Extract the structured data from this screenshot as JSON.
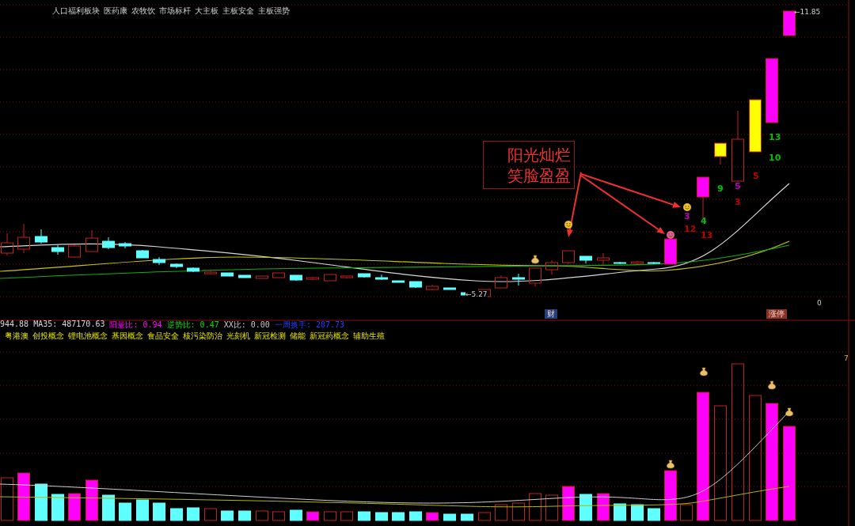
{
  "top_sector_tags": [
    "人口福利板块",
    "医药康",
    "农牧饮",
    "市场标杆",
    "大主板",
    "主板安全",
    "主板强势"
  ],
  "price_labels": {
    "high": "←11.85",
    "low": "←5.27",
    "right_scale": "0"
  },
  "annotation": {
    "lines": [
      "阳光灿烂",
      "笑脸盈盈"
    ]
  },
  "count_labels": [
    {
      "text": "9",
      "color": "#00c000"
    },
    {
      "text": "5",
      "color": "#c000c0"
    },
    {
      "text": "5",
      "color": "#c00000"
    },
    {
      "text": "3",
      "color": "#c00000"
    },
    {
      "text": "4",
      "color": "#00c000"
    },
    {
      "text": "12",
      "color": "#c00000"
    },
    {
      "text": "13",
      "color": "#c00000"
    },
    {
      "text": "13",
      "color": "#00c000"
    },
    {
      "text": "10",
      "color": "#00c000"
    },
    {
      "text": "3",
      "color": "#c000c0"
    }
  ],
  "date_markers": [
    {
      "text": "财",
      "color": "#23407a"
    },
    {
      "text": "涨停",
      "color": "#8a3320"
    }
  ],
  "indicators": [
    {
      "text": "944.88 MA35: 487170.63",
      "color": "#d8d8d8"
    },
    {
      "text": "阳量比: 0.94",
      "color": "#ff00ff"
    },
    {
      "text": "逆势比: 0.47",
      "color": "#00e000"
    },
    {
      "text": "XX比: 0.00",
      "color": "#c8c8c8"
    },
    {
      "text": "一周换手: 207.73",
      "color": "#2040ff"
    }
  ],
  "bottom_sector_tags": [
    "粤港澳",
    "创投概念",
    "锂电池概念",
    "基因概念",
    "食品安全",
    "核污染防治",
    "光刻机",
    "新冠检测",
    "储能",
    "新冠药概念",
    "辅助生殖"
  ],
  "volume_scale": "7"
}
